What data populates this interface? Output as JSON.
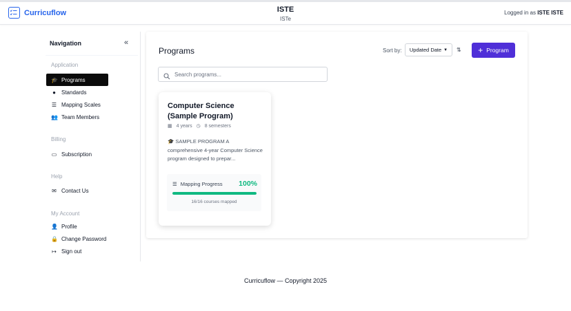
{
  "header": {
    "brand": "Curricuflow",
    "org_name": "ISTE",
    "org_sub": "ISTe",
    "login_prefix": "Logged in as",
    "login_user": "ISTE ISTE"
  },
  "sidebar": {
    "title": "Navigation",
    "collapse_icon": "double-chevron-left-icon",
    "sections": [
      {
        "label": "Application",
        "items": [
          {
            "label": "Programs",
            "icon": "graduation-cap-icon",
            "active": true
          },
          {
            "label": "Standards",
            "icon": "dot-icon"
          },
          {
            "label": "Mapping Scales",
            "icon": "sliders-icon"
          },
          {
            "label": "Team Members",
            "icon": "users-icon"
          }
        ]
      },
      {
        "label": "Billing",
        "items": [
          {
            "label": "Subscription",
            "icon": "credit-card-icon"
          }
        ]
      },
      {
        "label": "Help",
        "items": [
          {
            "label": "Contact Us",
            "icon": "envelope-icon"
          }
        ]
      },
      {
        "label": "My Account",
        "items": [
          {
            "label": "Profile",
            "icon": "user-icon"
          },
          {
            "label": "Change Password",
            "icon": "lock-icon"
          },
          {
            "label": "Sign out",
            "icon": "sign-out-icon"
          }
        ]
      }
    ]
  },
  "main": {
    "title": "Programs",
    "sort_label": "Sort by:",
    "sort_value": "Updated Date",
    "add_button": "Program",
    "search_placeholder": "Search programs...",
    "program": {
      "title": "Computer Science (Sample Program)",
      "years": "4 years",
      "semesters": "8 semesters",
      "description": "🎓 SAMPLE PROGRAM A comprehensive 4-year Computer Science program designed to prepar...",
      "progress_label": "Mapping Progress",
      "progress_pct": "100%",
      "progress_value": 1.0,
      "progress_note": "16/16 courses mapped"
    }
  },
  "footer": {
    "text": "Curricuflow — Copyright 2025"
  },
  "colors": {
    "brand": "#2563eb",
    "primary_button": "#4f2fd8",
    "success": "#10b981",
    "active_nav": "#0b0b0b"
  }
}
